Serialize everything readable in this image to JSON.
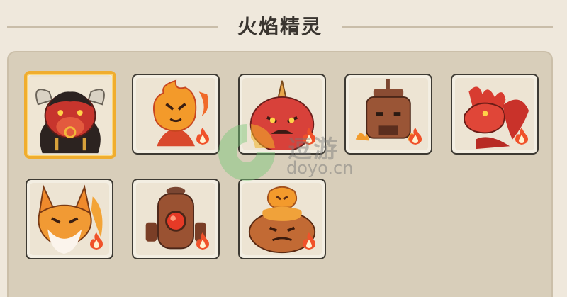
{
  "header": {
    "title": "火焰精灵"
  },
  "watermark": {
    "text_cn": "逗游",
    "text_en": "doyo.cn"
  },
  "colors": {
    "accent_selected": "#f0ad2e",
    "element_fire": "#f0522a"
  },
  "pets": [
    {
      "id": "pet-1",
      "name": "minotaur",
      "selected": true,
      "element_badge": "fire"
    },
    {
      "id": "pet-2",
      "name": "flame-spirit",
      "selected": false,
      "element_badge": "fire"
    },
    {
      "id": "pet-3",
      "name": "horned-blob",
      "selected": false,
      "element_badge": "fire"
    },
    {
      "id": "pet-4",
      "name": "brick-golem",
      "selected": false,
      "element_badge": "fire"
    },
    {
      "id": "pet-5",
      "name": "fire-dragon",
      "selected": false,
      "element_badge": "fire"
    },
    {
      "id": "pet-6",
      "name": "fire-fox",
      "selected": false,
      "element_badge": "fire"
    },
    {
      "id": "pet-7",
      "name": "furnace-robot",
      "selected": false,
      "element_badge": "fire"
    },
    {
      "id": "pet-8",
      "name": "lava-toad",
      "selected": false,
      "element_badge": "fire"
    }
  ]
}
